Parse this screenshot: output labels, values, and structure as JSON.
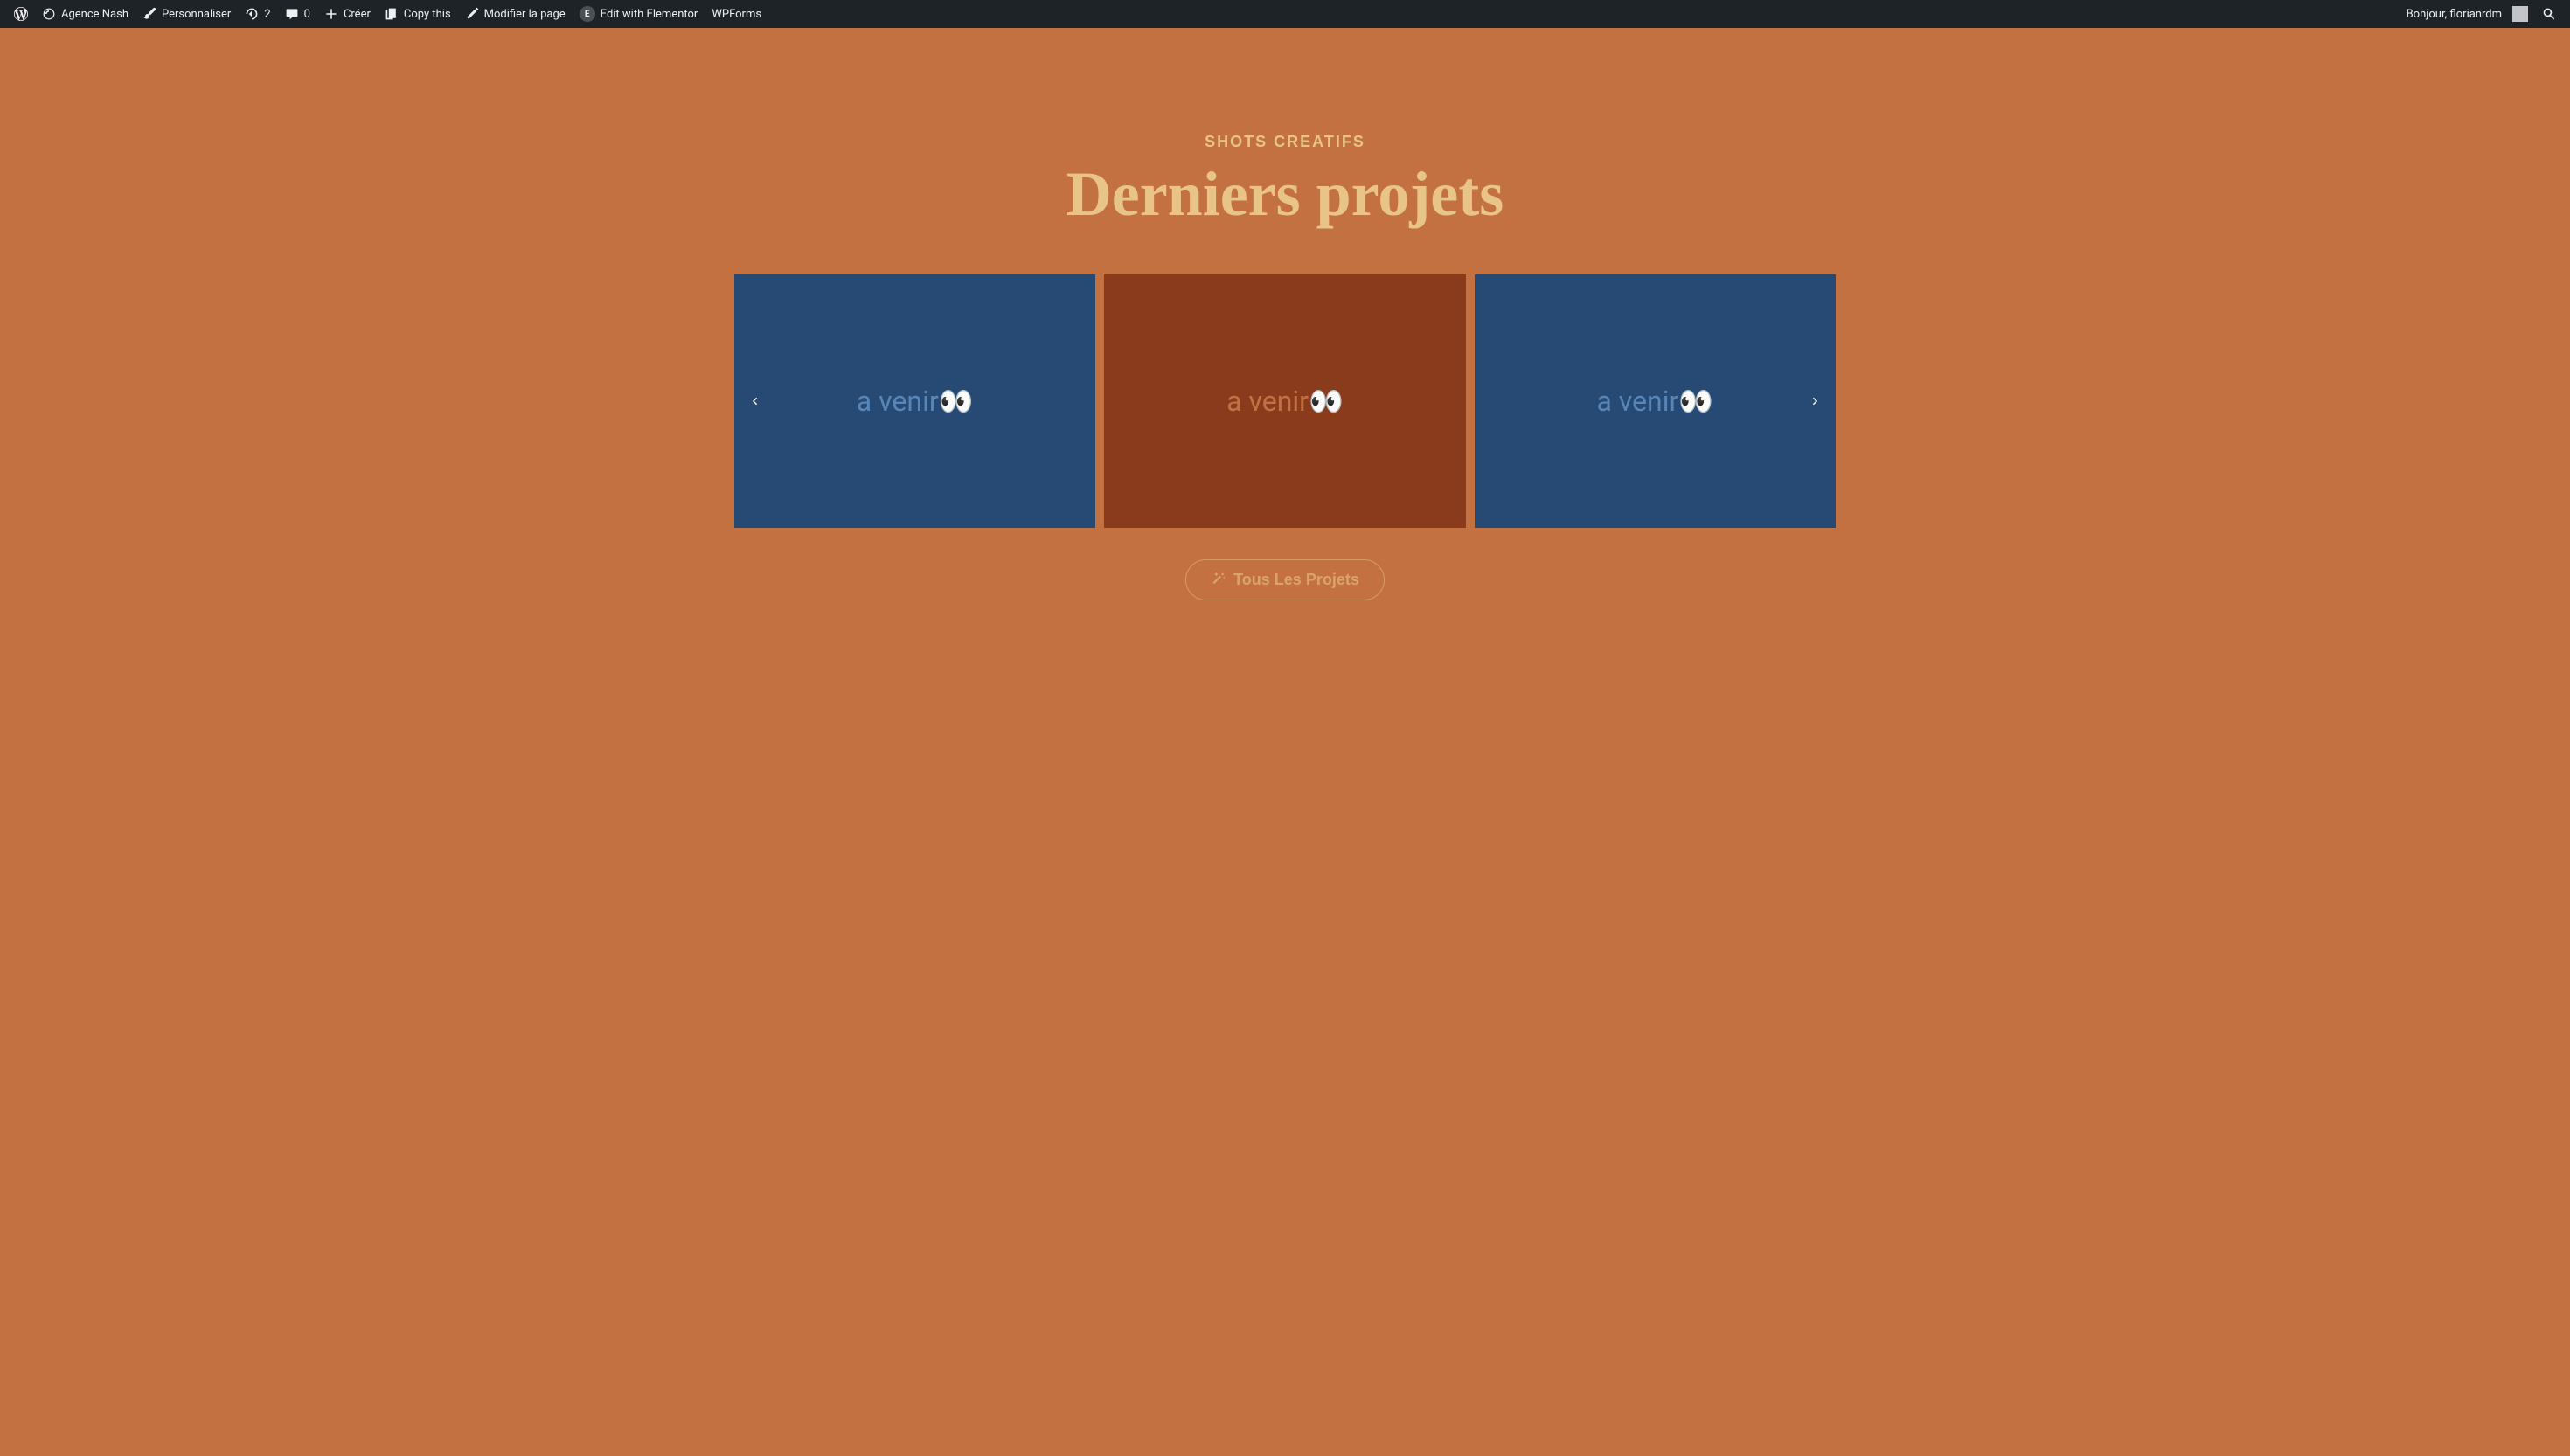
{
  "adminBar": {
    "siteName": "Agence Nash",
    "customize": "Personnaliser",
    "updates": "2",
    "comments": "0",
    "create": "Créer",
    "copyThis": "Copy this",
    "editPage": "Modifier la page",
    "editElementor": "Edit with Elementor",
    "wpforms": "WPForms",
    "greeting": "Bonjour, florianrdm"
  },
  "hero": {
    "subtitle": "SHOTS CREATIFS",
    "title": "Derniers projets"
  },
  "carousel": {
    "items": [
      {
        "text": "a venir👀",
        "style": "blue"
      },
      {
        "text": "a venir👀",
        "style": "brown"
      },
      {
        "text": "a venir👀",
        "style": "blue"
      }
    ]
  },
  "cta": {
    "label": "Tous Les Projets"
  }
}
